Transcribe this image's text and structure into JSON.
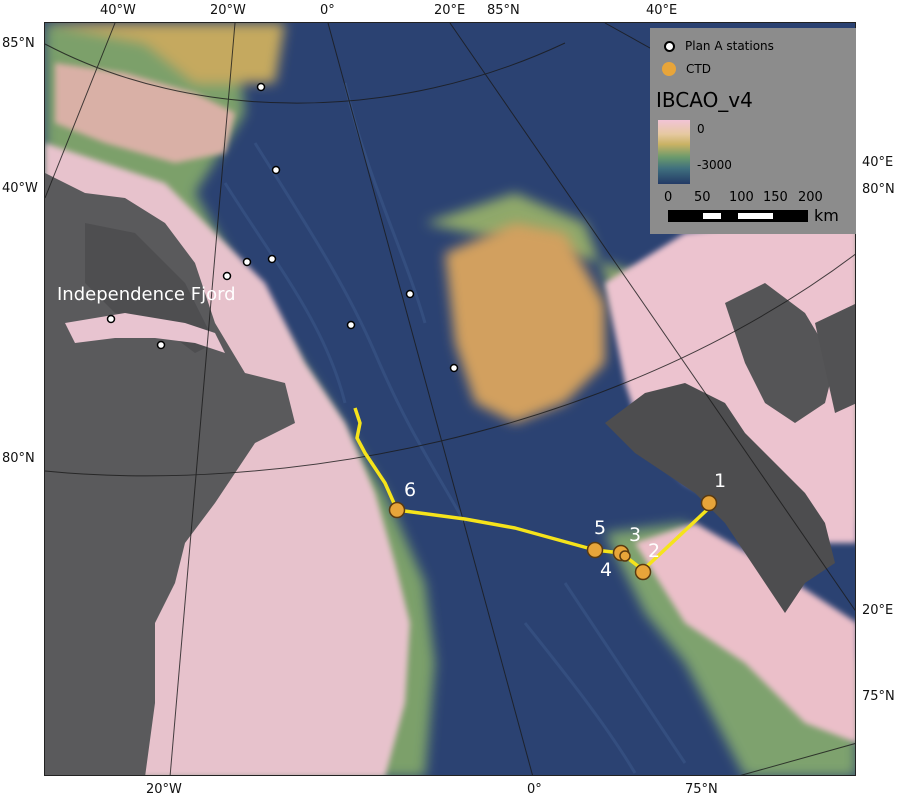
{
  "map": {
    "legend": {
      "plan_a_label": "Plan A stations",
      "ctd_label": "CTD",
      "bathymetry_title": "IBCAO_v4",
      "ramp_top_label": "0",
      "ramp_bottom_label": "-3000",
      "scale_ticks": [
        "0",
        "50",
        "100",
        "150",
        "200"
      ],
      "scale_unit": "km",
      "colors": {
        "ctd": "#e8a53a",
        "track": "#f5e31b",
        "panel": "#8c8c8c"
      }
    },
    "place_labels": {
      "fjord": "Independence Fjord"
    },
    "graticule_labels": {
      "top": [
        "40°W",
        "20°W",
        "0°",
        "20°E",
        "85°N",
        "40°E"
      ],
      "bottom": [
        "20°W",
        "0°",
        "75°N"
      ],
      "left": [
        "85°N",
        "40°W",
        "80°N"
      ],
      "right": [
        "40°E",
        "80°N",
        "20°E",
        "75°N"
      ]
    },
    "ctd_stations": [
      "1",
      "2",
      "3",
      "4",
      "5",
      "6"
    ],
    "plan_a_station_count": 10
  }
}
